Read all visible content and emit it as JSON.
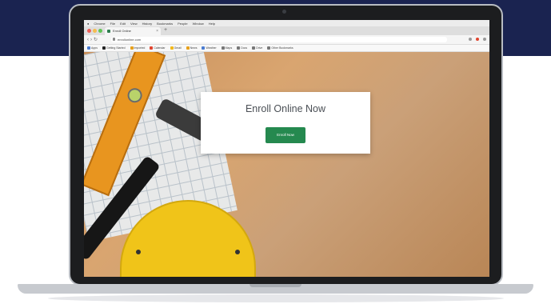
{
  "browser": {
    "menu_items": [
      "",
      "Chrome",
      "File",
      "Edit",
      "View",
      "History",
      "Bookmarks",
      "People",
      "Window",
      "Help"
    ],
    "tab_title": "Enroll Online",
    "url": "enrollonline.com",
    "bookmarks": [
      {
        "label": "Apps",
        "color": "#4a7bd0"
      },
      {
        "label": "Getting Started",
        "color": "#222222"
      },
      {
        "label": "Imported",
        "color": "#e7a01c"
      },
      {
        "label": "Calendar",
        "color": "#e0452f"
      },
      {
        "label": "Gmail",
        "color": "#f2b81b"
      },
      {
        "label": "News",
        "color": "#e7a01c"
      },
      {
        "label": "Weather",
        "color": "#4a7bd0"
      },
      {
        "label": "Maps",
        "color": "#777777"
      },
      {
        "label": "Docs",
        "color": "#777777"
      },
      {
        "label": "Drive",
        "color": "#777777"
      },
      {
        "label": "Other Bookmarks",
        "color": "#777777"
      }
    ]
  },
  "page": {
    "enroll_title": "Enroll Online Now",
    "enroll_button": "Enroll Now"
  },
  "colors": {
    "banner": "#1a2350",
    "accent_green": "#25894f",
    "hardhat_yellow": "#f0c419"
  }
}
